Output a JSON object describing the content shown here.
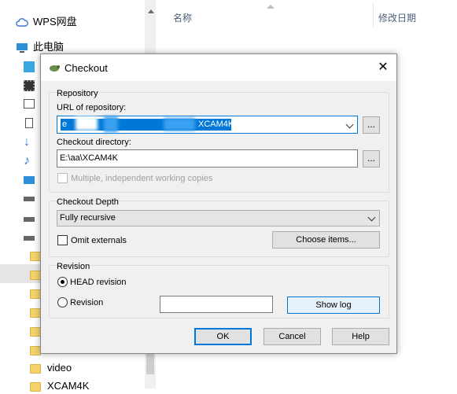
{
  "explorer": {
    "nav": {
      "wps_drive": "WPS网盘",
      "this_pc": "此电脑",
      "folder_video": "video",
      "folder_xcam": "XCAM4K"
    },
    "columns": {
      "name": "名称",
      "modified": "修改日期"
    }
  },
  "dialog": {
    "title": "Checkout",
    "close_glyph": "✕",
    "repository": {
      "group_label": "Repository",
      "url_label": "URL of repository:",
      "url_visible_tail": "XCAM4K",
      "url_prefix_char": "e",
      "checkout_dir_label": "Checkout directory:",
      "checkout_dir_value": "E:\\aa\\XCAM4K",
      "browse_label": "...",
      "multiple_wc_label": "Multiple, independent working copies"
    },
    "depth": {
      "group_label": "Checkout Depth",
      "selected": "Fully recursive",
      "omit_externals_label": "Omit externals",
      "choose_items_label": "Choose items..."
    },
    "revision": {
      "group_label": "Revision",
      "head_label": "HEAD revision",
      "revision_label": "Revision",
      "revision_value": "",
      "show_log_label": "Show log"
    },
    "buttons": {
      "ok": "OK",
      "cancel": "Cancel",
      "help": "Help"
    }
  }
}
